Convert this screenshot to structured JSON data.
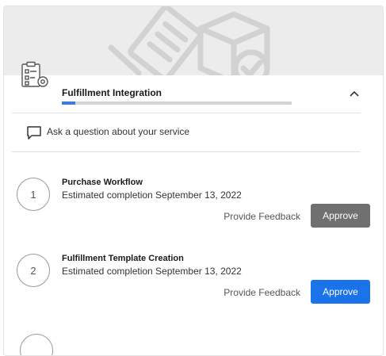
{
  "panel": {
    "title": "Fulfillment Integration",
    "title_progress_fraction": 0.06,
    "icons": {
      "banner": "box-with-checklist-illustration",
      "header": "clipboard-gear-icon",
      "collapse": "chevron-up-icon",
      "ask": "chat-bubble-icon"
    }
  },
  "ask": {
    "label": "Ask a question about your service"
  },
  "steps": [
    {
      "number": "1",
      "title": "Purchase Workflow",
      "subtitle": "Estimated completion September 13, 2022",
      "feedback_label": "Provide Feedback",
      "approve_label": "Approve",
      "approve_color": "#707070"
    },
    {
      "number": "2",
      "title": "Fulfillment Template Creation",
      "subtitle": "Estimated completion September 13, 2022",
      "feedback_label": "Provide Feedback",
      "approve_label": "Approve",
      "approve_color": "#1a73e8"
    }
  ],
  "colors": {
    "accent": "#1a73e8",
    "disabled_button": "#707070",
    "banner_bg": "#ececec",
    "progress": "#3b7dd8"
  }
}
